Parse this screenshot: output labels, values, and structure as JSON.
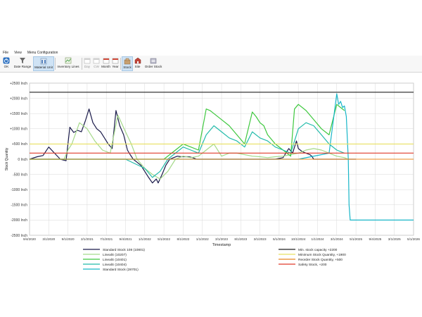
{
  "menu": [
    "File",
    "View",
    "Menu Configuration"
  ],
  "toolbar": {
    "ok": "OK",
    "date_range": "Date Range",
    "material_unit": "Material Unit",
    "inventory_lines": "Inventory Lines",
    "day": "Day",
    "cw": "CW",
    "month": "Month",
    "year": "Year",
    "stock": "Stock",
    "site": "Site",
    "order_stock": "Order Stock"
  },
  "colors": {
    "toolbar_active": "#cfe3f5",
    "grid": "#d8d8d8"
  },
  "chart_data": {
    "type": "line",
    "ylabel": "Stock Quantity",
    "xlabel": "Timestamp",
    "ylim": [
      -2500,
      2500
    ],
    "y_ticks": [
      "+2500 Inch",
      "+2000 Inch",
      "+1500 Inch",
      "+1000 Inch",
      "+500 Inch",
      "0 Inch",
      "-500 Inch",
      "-1000 Inch",
      "-1500 Inch",
      "-2000 Inch",
      "-2500 Inch"
    ],
    "x_ticks": [
      "9/4/2020",
      "3/1/2020",
      "9/1/2020",
      "2/1/2021",
      "7/1/2021",
      "9/4/2021",
      "1/1/2022",
      "5/1/2022",
      "8/1/2022",
      "1/1/2022",
      "3/1/2023",
      "8/1/2023",
      "3/1/2023",
      "5/1/2024",
      "10/1/2024",
      "1/1/2024",
      "3/1/2024",
      "5/1/2025",
      "9/4/2025",
      "3/1/2025",
      "5/1/2026"
    ],
    "grid": true,
    "legend_position": "bottom",
    "series": [
      {
        "name": "Standard Stock 108 (10801)",
        "color": "#1a1a4a",
        "x": [
          0,
          0.02,
          0.035,
          0.05,
          0.065,
          0.08,
          0.095,
          0.105,
          0.115,
          0.125,
          0.135,
          0.145,
          0.155,
          0.165,
          0.175,
          0.185,
          0.195,
          0.205,
          0.215,
          0.225,
          0.235,
          0.245,
          0.255,
          0.262,
          0.27,
          0.28,
          0.29,
          0.3,
          0.31,
          0.32,
          0.33,
          0.335,
          0.345,
          0.355,
          0.365,
          0.375,
          0.385,
          0.395,
          0.405,
          0.415,
          0.425,
          0.435,
          0.45,
          0.5,
          0.55,
          0.6,
          0.64,
          0.66,
          0.67,
          0.675,
          0.685,
          0.695,
          0.7,
          0.71,
          0.72,
          0.73,
          0.735,
          0.74,
          0.75,
          0.76,
          0.77,
          0.78,
          0.79,
          0.8,
          0.81,
          0.82,
          0.83,
          0.84,
          0.85
        ],
        "y": [
          0,
          80,
          120,
          400,
          200,
          0,
          -50,
          1050,
          880,
          950,
          900,
          1250,
          1650,
          1200,
          1000,
          900,
          700,
          500,
          350,
          1600,
          1100,
          800,
          300,
          150,
          0,
          -100,
          -200,
          -400,
          -600,
          -780,
          -650,
          -780,
          -500,
          -200,
          0,
          50,
          100,
          80,
          80,
          80,
          50,
          0,
          0,
          0,
          0,
          0,
          0,
          50,
          250,
          350,
          200,
          600,
          350,
          250,
          200,
          150,
          100,
          0,
          0,
          0,
          0,
          0,
          0,
          0,
          0,
          0,
          0,
          0,
          0
        ]
      },
      {
        "name": "LinealS (10207)",
        "color": "#a5d98a",
        "x": [
          0,
          0.05,
          0.07,
          0.09,
          0.1,
          0.11,
          0.13,
          0.15,
          0.17,
          0.19,
          0.21,
          0.23,
          0.25,
          0.265,
          0.28,
          0.3,
          0.32,
          0.34,
          0.36,
          0.38,
          0.4,
          0.42,
          0.44,
          0.46,
          0.48,
          0.5,
          0.52,
          0.54,
          0.56,
          0.58,
          0.6,
          0.62,
          0.64,
          0.66,
          0.68,
          0.7,
          0.72,
          0.74,
          0.76,
          0.78,
          0.8,
          0.82,
          0.83
        ],
        "y": [
          0,
          0,
          0,
          0,
          300,
          500,
          1200,
          1000,
          600,
          300,
          200,
          1450,
          900,
          500,
          0,
          -300,
          -500,
          -650,
          -400,
          0,
          100,
          50,
          100,
          300,
          500,
          100,
          200,
          200,
          150,
          100,
          80,
          50,
          80,
          100,
          150,
          200,
          300,
          350,
          300,
          200,
          100,
          50,
          0
        ]
      },
      {
        "name": "LinealS (10401)",
        "color": "#3ec83e",
        "x": [
          0,
          0.05,
          0.1,
          0.15,
          0.2,
          0.25,
          0.3,
          0.35,
          0.4,
          0.42,
          0.44,
          0.46,
          0.47,
          0.48,
          0.5,
          0.52,
          0.54,
          0.56,
          0.58,
          0.59,
          0.6,
          0.61,
          0.62,
          0.64,
          0.66,
          0.68,
          0.69,
          0.7,
          0.72,
          0.74,
          0.76,
          0.78,
          0.8,
          0.81,
          0.82
        ],
        "y": [
          0,
          0,
          0,
          0,
          0,
          0,
          0,
          0,
          500,
          400,
          300,
          1650,
          1600,
          1500,
          1300,
          1100,
          800,
          500,
          1550,
          1400,
          1200,
          1100,
          800,
          500,
          300,
          100,
          1650,
          1800,
          1600,
          1300,
          1000,
          800,
          1800,
          1700,
          1600
        ]
      },
      {
        "name": "LinealS (10404)",
        "color": "#22bbaa",
        "x": [
          0,
          0.05,
          0.1,
          0.15,
          0.2,
          0.25,
          0.3,
          0.32,
          0.34,
          0.36,
          0.38,
          0.4,
          0.42,
          0.44,
          0.46,
          0.48,
          0.5,
          0.52,
          0.54,
          0.56,
          0.58,
          0.6,
          0.62,
          0.64,
          0.66,
          0.68,
          0.7,
          0.72,
          0.74,
          0.76,
          0.78,
          0.8,
          0.82
        ],
        "y": [
          0,
          0,
          0,
          0,
          0,
          0,
          -300,
          -600,
          -400,
          0,
          200,
          400,
          300,
          200,
          800,
          1100,
          900,
          700,
          600,
          400,
          900,
          700,
          600,
          400,
          300,
          200,
          1000,
          1200,
          1100,
          800,
          500,
          300,
          200
        ]
      },
      {
        "name": "Standard Stock (28701)",
        "color": "#18b6c8",
        "x": [
          0,
          0.1,
          0.2,
          0.3,
          0.4,
          0.5,
          0.6,
          0.7,
          0.78,
          0.8,
          0.805,
          0.81,
          0.815,
          0.82,
          0.825,
          0.83,
          0.832,
          0.835,
          0.84,
          0.9,
          1.0
        ],
        "y": [
          0,
          0,
          0,
          0,
          0,
          0,
          0,
          0,
          200,
          2150,
          1800,
          1900,
          1700,
          1750,
          1400,
          0,
          -1500,
          -2000,
          -2000,
          -2000,
          -2000
        ]
      },
      {
        "name": "Min. stock capacity +2200",
        "color": "#222222",
        "y_const": 2200
      },
      {
        "name": "Minimum Stock Quantity, +1900",
        "color": "#e8e060",
        "y_const": 500
      },
      {
        "name": "Reorder Stock Quantity, +500",
        "color": "#e88820",
        "y_const": 0
      },
      {
        "name": "Safety Stock, +200",
        "color": "#e03a2a",
        "y_const": 200
      }
    ]
  }
}
